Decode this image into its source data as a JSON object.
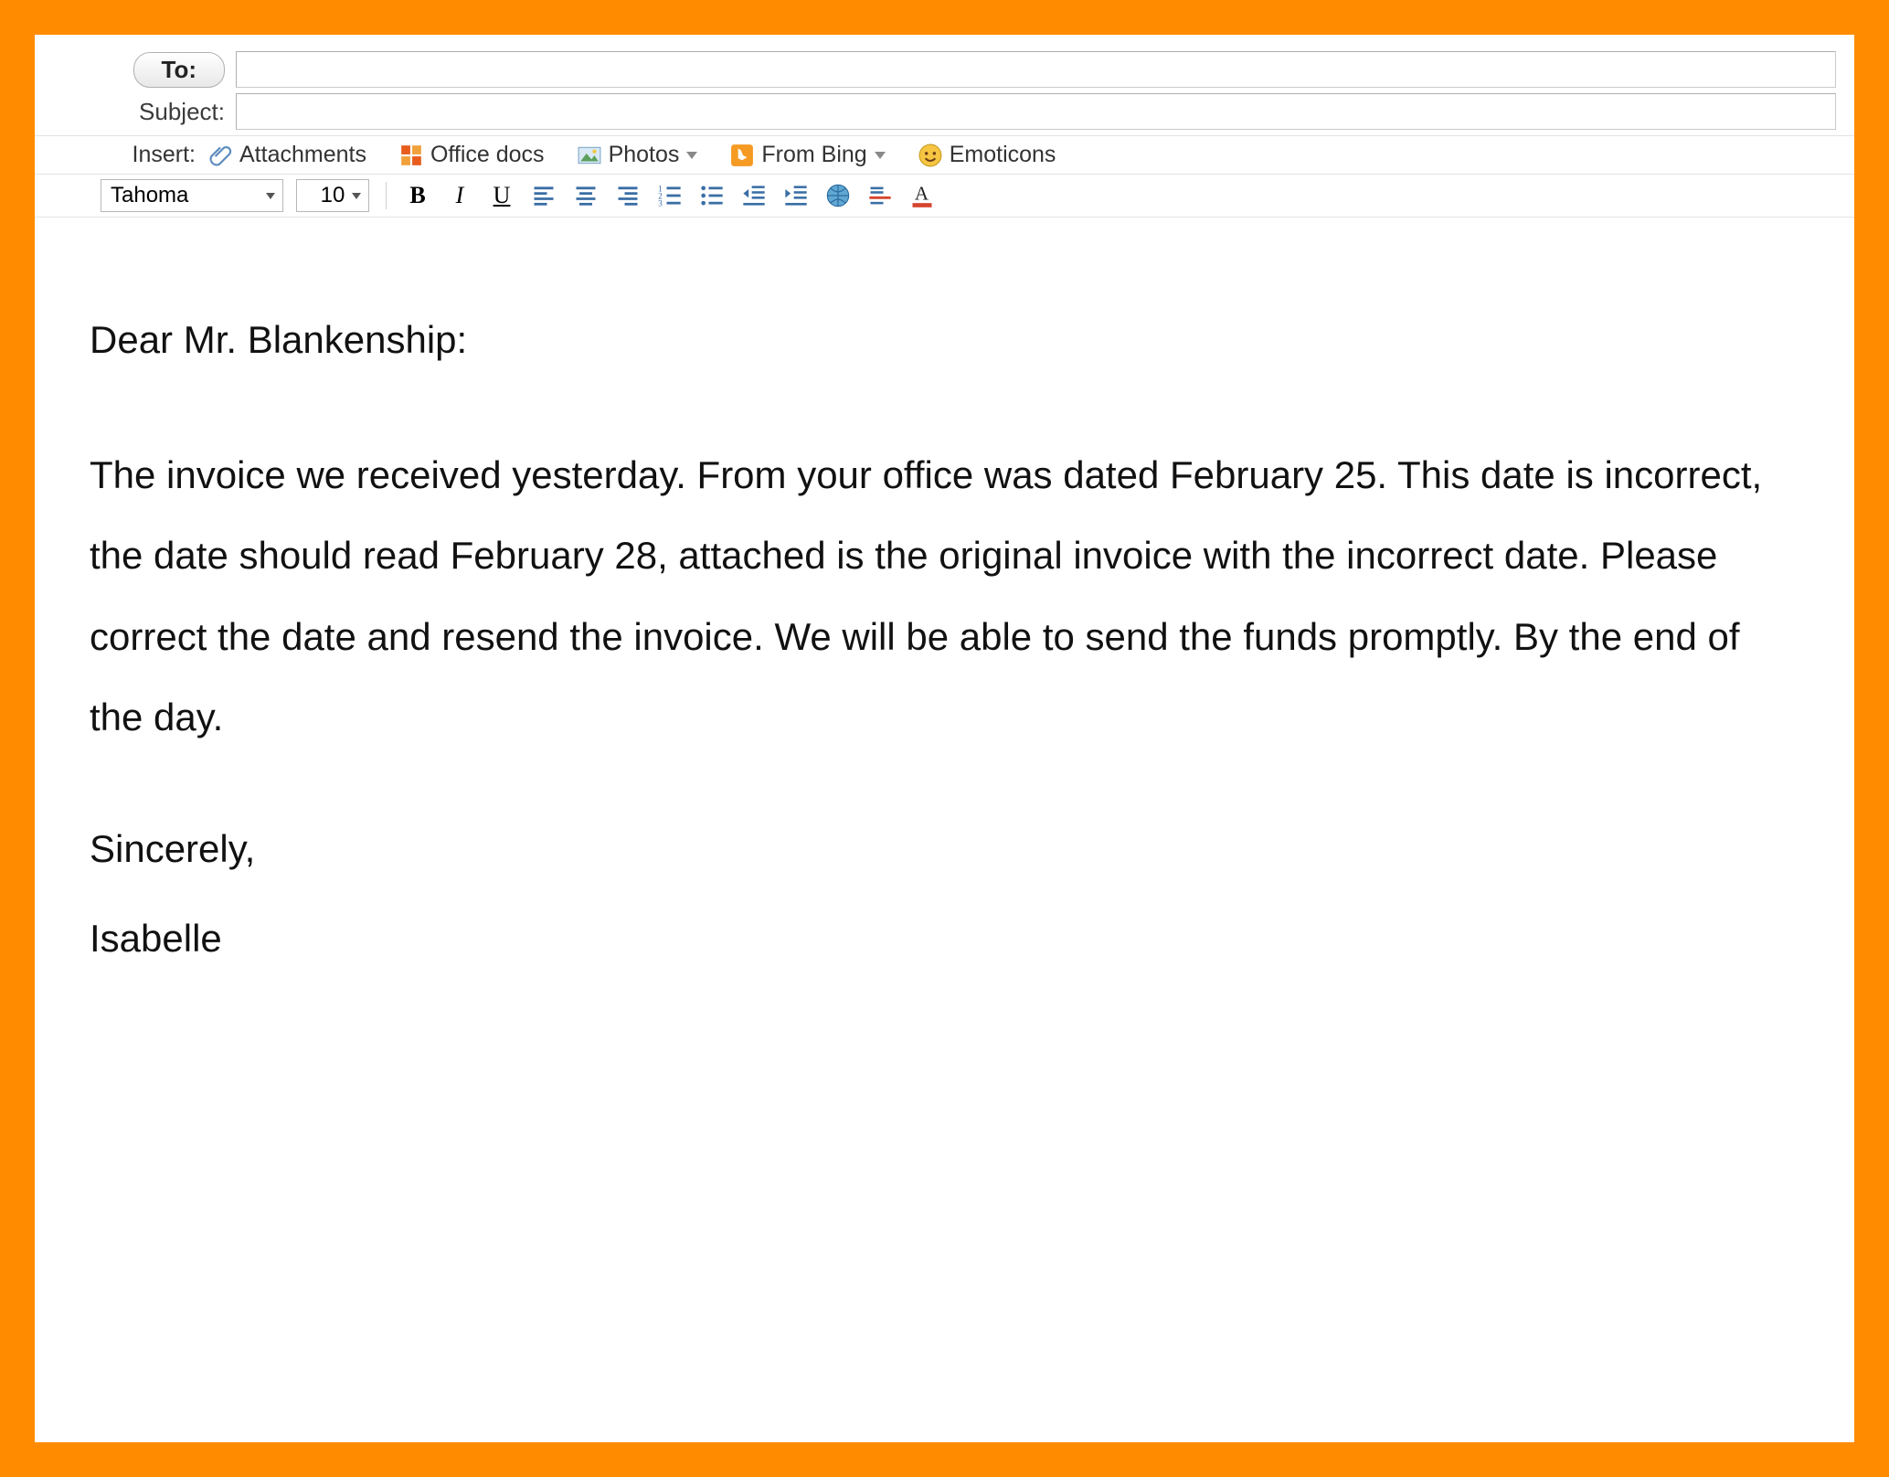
{
  "fields": {
    "to_label": "To:",
    "to_value": "",
    "subject_label": "Subject:",
    "subject_value": ""
  },
  "insert": {
    "label": "Insert:",
    "attachments": "Attachments",
    "office_docs": "Office docs",
    "photos": "Photos",
    "from_bing": "From Bing",
    "emoticons": "Emoticons"
  },
  "format": {
    "font": "Tahoma",
    "size": "10"
  },
  "body": {
    "greeting": "Dear Mr. Blankenship:",
    "paragraph": "The invoice we received yesterday. From your office was dated February 25.  This date is incorrect, the date should read February 28, attached is the original invoice with the incorrect date. Please correct the date and resend the invoice. We will be able to send the funds promptly. By the end of the day.",
    "closing": "Sincerely,",
    "signature": "Isabelle"
  }
}
